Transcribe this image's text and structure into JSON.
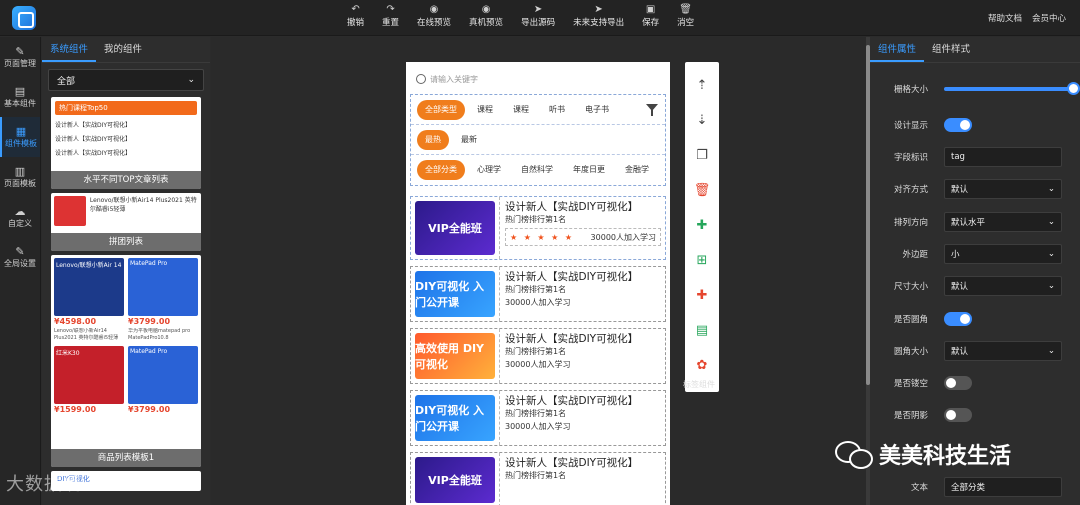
{
  "toolbar": {
    "tools": [
      {
        "label": "撤销",
        "icon": "undo-icon",
        "glyph": "↶"
      },
      {
        "label": "重置",
        "icon": "redo-icon",
        "glyph": "↷"
      },
      {
        "label": "在线预览",
        "icon": "eye-icon",
        "glyph": "◉"
      },
      {
        "label": "真机预览",
        "icon": "eye-icon",
        "glyph": "◉"
      },
      {
        "label": "导出源码",
        "icon": "send-icon",
        "glyph": "➤"
      },
      {
        "label": "未来支持导出",
        "icon": "send-icon",
        "glyph": "➤"
      },
      {
        "label": "保存",
        "icon": "save-icon",
        "glyph": "▣"
      },
      {
        "label": "消空",
        "icon": "trash-icon",
        "glyph": "🗑"
      }
    ],
    "help": "帮助文档",
    "member": "会员中心"
  },
  "rail": [
    {
      "label": "页面管理",
      "icon": "pen-icon",
      "glyph": "✎"
    },
    {
      "label": "基本组件",
      "icon": "image-icon",
      "glyph": "▤"
    },
    {
      "label": "组件模板",
      "icon": "template-icon",
      "glyph": "▦",
      "active": true
    },
    {
      "label": "页面模板",
      "icon": "page-template-icon",
      "glyph": "▥"
    },
    {
      "label": "自定义",
      "icon": "cloud-icon",
      "glyph": "☁"
    },
    {
      "label": "全局设置",
      "icon": "pen-icon",
      "glyph": "✎"
    }
  ],
  "components": {
    "tabs": [
      "系统组件",
      "我的组件"
    ],
    "filter": "全部",
    "thumbs": [
      {
        "caption": "水平不同TOP文章列表",
        "header": "热门课程Top50",
        "rows": [
          "设计新人【实战DIY可视化】",
          "设计新人【实战DIY可视化】",
          "设计新人【实战DIY可视化】"
        ]
      },
      {
        "caption": "拼团列表",
        "header": "Lenovo/联想小新Air14 Plus2021 英特尔酷睿i5轻薄"
      },
      {
        "caption": "商品列表模板1",
        "products": [
          {
            "name": "Lenovo/联想小新Air 14",
            "price": "¥4598.00",
            "sub": "Lenovo/联想小新Air14 Plus2021 英特尔酷睿i5轻薄"
          },
          {
            "name": "MatePad Pro",
            "price": "¥3799.00",
            "sub": "华为平板电脑matepad pro MatePadPro10.8"
          },
          {
            "name": "红米K30",
            "price": "¥1599.00",
            "sub": ""
          },
          {
            "name": "MatePad Pro",
            "price": "¥3799.00",
            "sub": ""
          }
        ]
      },
      {
        "caption": "",
        "header": "DIY可视化"
      }
    ]
  },
  "phone": {
    "search_placeholder": "请输入关键字",
    "filter_rows": [
      [
        "全部类型",
        "课程",
        "课程",
        "听书",
        "电子书"
      ],
      [
        "最热",
        "最新"
      ],
      [
        "全部分类",
        "心理学",
        "自然科学",
        "年度日更",
        "金融学"
      ]
    ],
    "cards": [
      {
        "style": "navy",
        "banner": "VIP全能班",
        "title": "设计新人【实战DIY可视化】",
        "rank": "热门榜排行第1名",
        "join": "30000人加入学习",
        "stars": "★ ★ ★ ★ ★"
      },
      {
        "style": "blue",
        "banner": "DIY可视化 入门公开课",
        "title": "设计新人【实战DIY可视化】",
        "rank": "热门榜排行第1名",
        "join": "30000人加入学习"
      },
      {
        "style": "orange",
        "banner": "高效使用 DIY可视化",
        "title": "设计新人【实战DIY可视化】",
        "rank": "热门榜排行第1名",
        "join": "30000人加入学习"
      },
      {
        "style": "blue",
        "banner": "DIY可视化 入门公开课",
        "title": "设计新人【实战DIY可视化】",
        "rank": "热门榜排行第1名",
        "join": "30000人加入学习"
      },
      {
        "style": "navy",
        "banner": "VIP全能班",
        "title": "设计新人【实战DIY可视化】",
        "rank": "热门榜排行第1名",
        "join": ""
      }
    ]
  },
  "sidetools": {
    "items": [
      {
        "icon": "move-up-icon",
        "glyph": "⇡",
        "color": "#444"
      },
      {
        "icon": "move-down-icon",
        "glyph": "⇣",
        "color": "#444"
      },
      {
        "icon": "copy-icon",
        "glyph": "❐",
        "color": "#444"
      },
      {
        "icon": "delete-icon",
        "glyph": "🗑",
        "color": "#e5462f"
      },
      {
        "icon": "puzzle-icon",
        "glyph": "✚",
        "color": "#26a65b"
      },
      {
        "icon": "add-file-icon",
        "glyph": "⊞",
        "color": "#26a65b"
      },
      {
        "icon": "puzzle-red-icon",
        "glyph": "✚",
        "color": "#e5462f"
      },
      {
        "icon": "document-icon",
        "glyph": "▤",
        "color": "#26a65b"
      },
      {
        "icon": "settings-icon",
        "glyph": "✿",
        "color": "#e5462f"
      }
    ],
    "label": "标签组件"
  },
  "props": {
    "tabs": [
      "组件属性",
      "组件样式"
    ],
    "rows": {
      "grid_size": "栅格大小",
      "design_display": "设计显示",
      "field_id": "字段标识",
      "field_id_value": "tag",
      "align": "对齐方式",
      "align_value": "默认",
      "direction": "排列方向",
      "direction_value": "默认水平",
      "margin": "外边距",
      "margin_value": "小",
      "size": "尺寸大小",
      "size_value": "默认",
      "rounded": "是否圆角",
      "radius": "圆角大小",
      "radius_value": "默认",
      "hollow": "是否镂空",
      "shadow": "是否阴影",
      "text": "文本",
      "text_value": "全部分类"
    }
  },
  "watermark": "美美科技生活",
  "brand_watermark": "大数据境",
  "colors": {
    "accent": "#3a9cff",
    "orange": "#f07d1c",
    "red": "#e5462f",
    "green": "#26a65b"
  }
}
